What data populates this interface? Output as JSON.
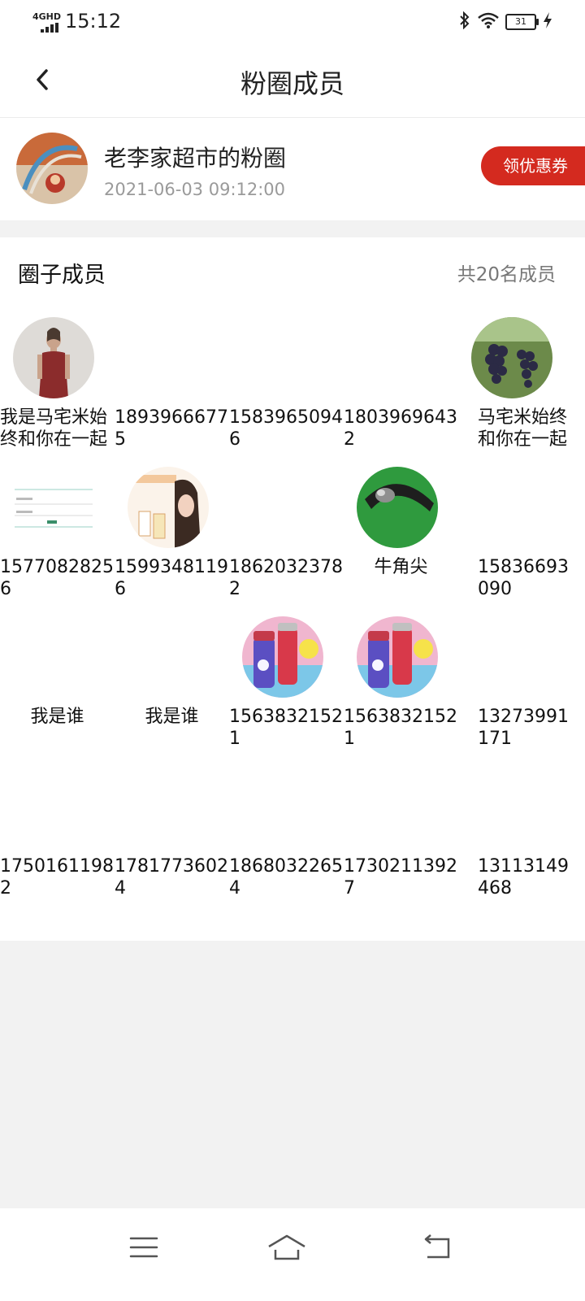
{
  "status_bar": {
    "network": "4GHD",
    "time": "15:12",
    "battery": "31"
  },
  "header": {
    "title": "粉圈成员"
  },
  "circle": {
    "name": "老李家超市的粉圈",
    "created_at": "2021-06-03 09:12:00",
    "coupon_button": "领优惠券"
  },
  "members_section": {
    "title": "圈子成员",
    "count_text": "共20名成员"
  },
  "members": [
    {
      "name": "我是马宅米始终和你在一起",
      "avatar": "woman-red-dress-photo"
    },
    {
      "name": "18939666775",
      "avatar": ""
    },
    {
      "name": "15839650946",
      "avatar": ""
    },
    {
      "name": "18039696432",
      "avatar": ""
    },
    {
      "name": "马宅米始终和你在一起",
      "avatar": "grapes-photo"
    },
    {
      "name": "15770828256",
      "avatar": "form-screenshot"
    },
    {
      "name": "15993481196",
      "avatar": "milk-powder-ad-photo"
    },
    {
      "name": "18620323782",
      "avatar": "horn-photo"
    },
    {
      "name": "牛角尖",
      "avatar": ""
    },
    {
      "name": "15836693090",
      "avatar": ""
    },
    {
      "name": "我是谁",
      "avatar": ""
    },
    {
      "name": "我是谁",
      "avatar": ""
    },
    {
      "name": "15638321521",
      "avatar": "water-bottles-photo"
    },
    {
      "name": "15638321521",
      "avatar": "water-bottles-photo"
    },
    {
      "name": "13273991171",
      "avatar": ""
    },
    {
      "name": "17501611982",
      "avatar": ""
    },
    {
      "name": "17817736024",
      "avatar": ""
    },
    {
      "name": "18680322654",
      "avatar": ""
    },
    {
      "name": "17302113927",
      "avatar": ""
    },
    {
      "name": "13113149468",
      "avatar": ""
    }
  ],
  "nav": {
    "menu_icon": "menu-icon",
    "home_icon": "home-icon",
    "back_icon": "return-icon"
  },
  "colors": {
    "accent": "#d42a1f",
    "background": "#f2f2f2"
  }
}
